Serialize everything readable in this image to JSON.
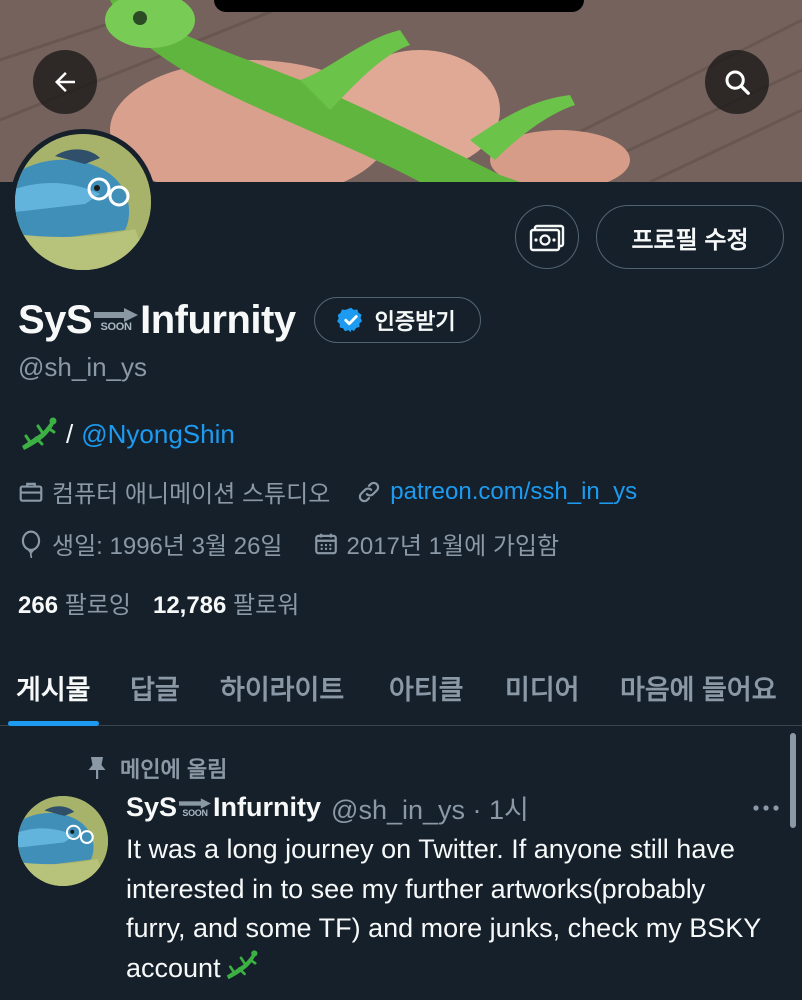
{
  "header": {
    "back_icon": "back-arrow-icon",
    "search_icon": "search-icon"
  },
  "profile": {
    "name_left": "SyS",
    "name_soon": "SOON",
    "name_right": "Infurnity",
    "verify_label": "인증받기",
    "handle": "@sh_in_ys",
    "edit_label": "프로필 수정",
    "bio_separator": "/",
    "bio_mention": "@NyongShin",
    "category": "컴퓨터 애니메이션 스튜디오",
    "website": "patreon.com/ssh_in_ys",
    "birthday": "생일: 1996년 3월 26일",
    "joined": "2017년 1월에 가입함",
    "following_count": "266",
    "following_label": "팔로잉",
    "followers_count": "12,786",
    "followers_label": "팔로워"
  },
  "tabs": [
    {
      "label": "게시물",
      "active": true
    },
    {
      "label": "답글",
      "active": false
    },
    {
      "label": "하이라이트",
      "active": false
    },
    {
      "label": "아티클",
      "active": false
    },
    {
      "label": "미디어",
      "active": false
    },
    {
      "label": "마음에 들어요",
      "active": false
    }
  ],
  "pinned_tweet": {
    "pinned_label": "메인에 올림",
    "author_left": "SyS",
    "author_soon": "SOON",
    "author_right": "Infurnity",
    "handle_time": "@sh_in_ys · 1시",
    "text": "It was a long journey on Twitter. If anyone still have interested in to see my further artworks(probably furry, and some TF) and more junks, check my BSKY account"
  },
  "colors": {
    "background": "#15202b",
    "accent": "#1d9bf0",
    "muted": "#8b98a5"
  }
}
